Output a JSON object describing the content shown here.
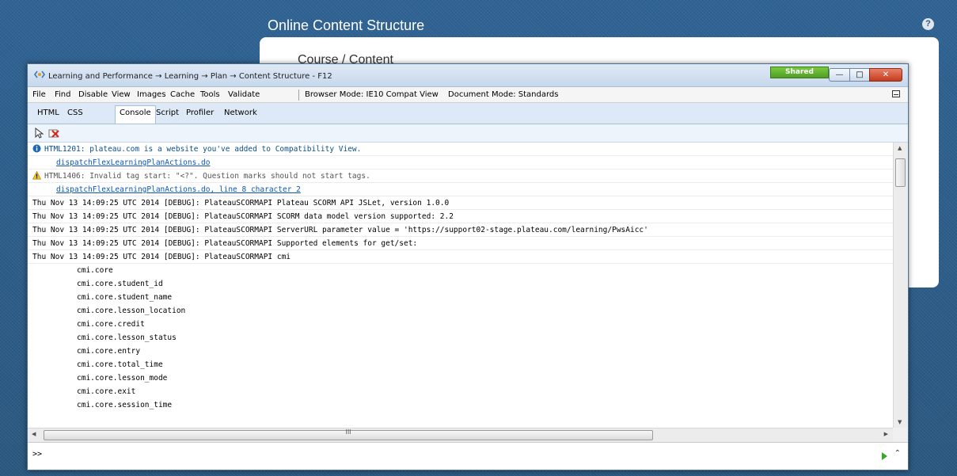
{
  "background": {
    "heading": "Online Content Structure",
    "help_glyph": "?",
    "panel_text": "Course / Content"
  },
  "devtools": {
    "title": "Learning and Performance → Learning → Plan → Content Structure - F12",
    "shared_badge": "Shared",
    "window_buttons": {
      "minimize": "—",
      "maximize": "□",
      "close": "✕"
    },
    "menu": {
      "items": [
        "File",
        "Find",
        "Disable",
        "View",
        "Images",
        "Cache",
        "Tools",
        "Validate"
      ],
      "browser_mode": "Browser Mode: IE10 Compat View",
      "document_mode": "Document Mode: Standards"
    },
    "tabs": [
      "HTML",
      "CSS",
      "Console",
      "Script",
      "Profiler",
      "Network"
    ],
    "active_tab": "Console",
    "toolbar_icons": [
      "select-element-icon",
      "clear-console-icon"
    ]
  },
  "console": {
    "messages": [
      "HTML1201: plateau.com is a website you've added to Compatibility View.",
      "dispatchFlexLearningPlanActions.do",
      "HTML1406: Invalid tag start: \"<?\". Question marks should not start tags.",
      "dispatchFlexLearningPlanActions.do, line 8 character 2",
      "Thu Nov 13 14:09:25 UTC 2014 [DEBUG]: PlateauSCORMAPI Plateau SCORM API JSLet, version 1.0.0",
      "Thu Nov 13 14:09:25 UTC 2014 [DEBUG]: PlateauSCORMAPI SCORM data model version supported: 2.2",
      "Thu Nov 13 14:09:25 UTC 2014 [DEBUG]: PlateauSCORMAPI ServerURL parameter value = 'https://support02-stage.plateau.com/learning/PwsAicc'",
      "Thu Nov 13 14:09:25 UTC 2014 [DEBUG]: PlateauSCORMAPI Supported elements for get/set:",
      "Thu Nov 13 14:09:25 UTC 2014 [DEBUG]: PlateauSCORMAPI cmi"
    ],
    "elements": [
      "cmi.core",
      "cmi.core.student_id",
      "cmi.core.student_name",
      "cmi.core.lesson_location",
      "cmi.core.credit",
      "cmi.core.lesson_status",
      "cmi.core.entry",
      "cmi.core.total_time",
      "cmi.core.lesson_mode",
      "cmi.core.exit",
      "cmi.core.session_time"
    ],
    "hscroll_grip": "III",
    "prompt": ">>"
  }
}
